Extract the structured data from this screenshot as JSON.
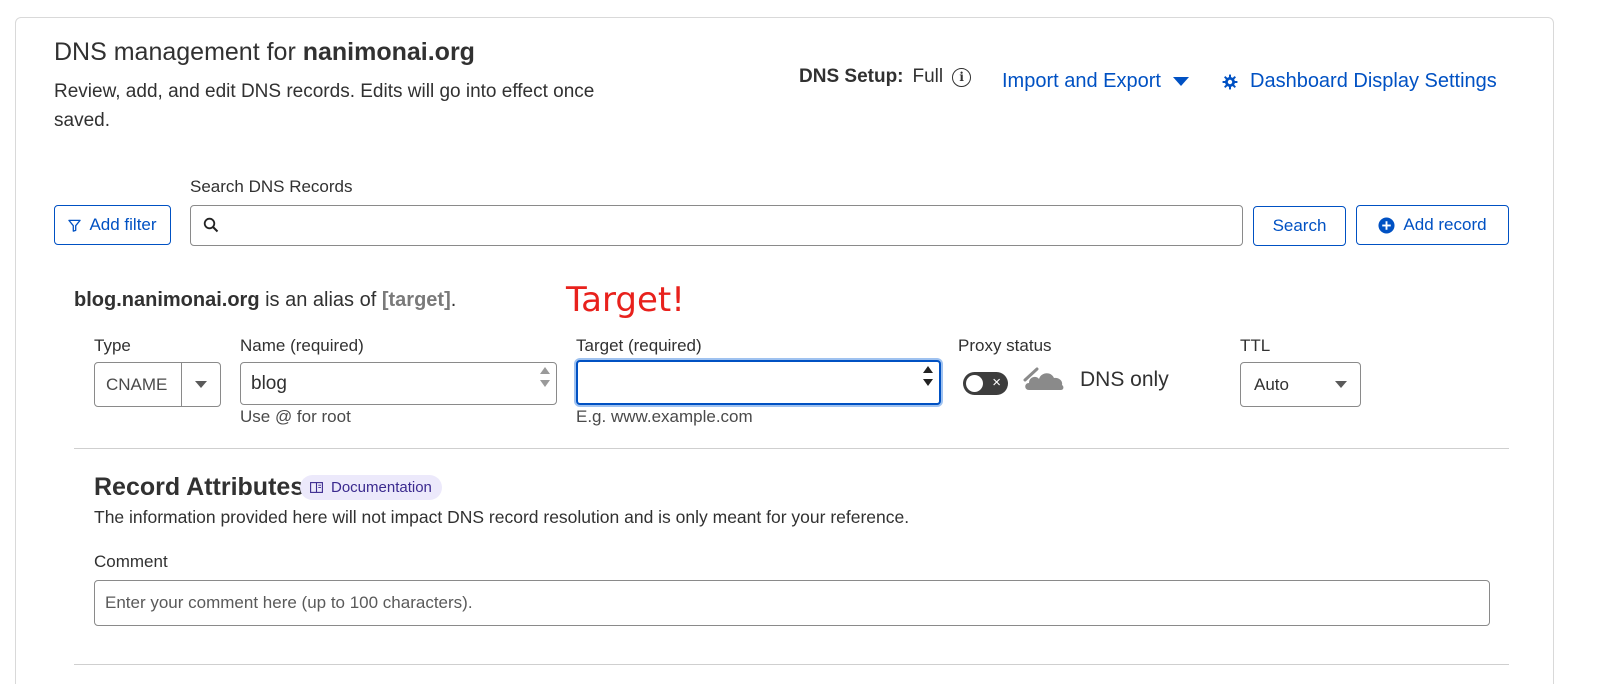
{
  "header": {
    "title_prefix": "DNS management for ",
    "domain": "nanimonai.org",
    "description": "Review, add, and edit DNS records. Edits will go into effect once saved.",
    "dns_setup_label": "DNS Setup:",
    "dns_setup_value": "Full",
    "import_export_label": "Import and Export",
    "display_settings_label": "Dashboard Display Settings"
  },
  "search": {
    "label": "Search DNS Records",
    "placeholder": "",
    "add_filter_label": "Add filter",
    "search_button_label": "Search",
    "add_record_label": "Add record"
  },
  "record_form": {
    "alias_host": "blog.nanimonai.org",
    "alias_middle": " is an alias of ",
    "alias_target": "[target]",
    "alias_end": ".",
    "annotation": "Target!",
    "type_label": "Type",
    "type_value": "CNAME",
    "name_label": "Name (required)",
    "name_value": "blog",
    "name_hint": "Use @ for root",
    "target_label": "Target (required)",
    "target_value": "",
    "target_hint": "E.g. www.example.com",
    "proxy_label": "Proxy status",
    "proxy_value": "DNS only",
    "ttl_label": "TTL",
    "ttl_value": "Auto"
  },
  "attributes": {
    "title": "Record Attributes",
    "doc_badge": "Documentation",
    "description": "The information provided here will not impact DNS record resolution and is only meant for your reference.",
    "comment_label": "Comment",
    "comment_placeholder": "Enter your comment here (up to 100 characters)."
  },
  "colors": {
    "link_blue": "#0051c3",
    "annotation_red": "#e8211c",
    "badge_bg": "#ece9fb"
  }
}
